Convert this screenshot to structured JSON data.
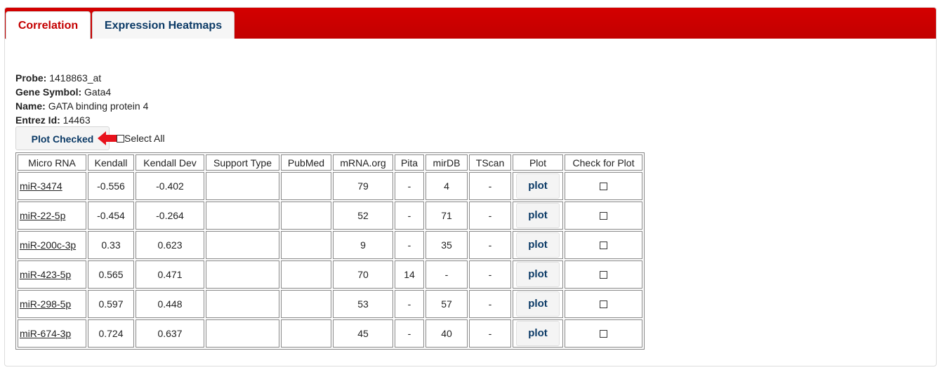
{
  "tabs": [
    {
      "label": "Correlation",
      "active": true
    },
    {
      "label": "Expression Heatmaps",
      "active": false
    }
  ],
  "info": {
    "probe_label": "Probe:",
    "probe_value": "1418863_at",
    "gene_symbol_label": "Gene Symbol:",
    "gene_symbol_value": "Gata4",
    "name_label": "Name:",
    "name_value": "GATA binding protein 4",
    "entrez_label": "Entrez Id:",
    "entrez_value": "14463"
  },
  "controls": {
    "plot_checked_label": "Plot Checked",
    "select_all_label": "Select All"
  },
  "table": {
    "headers": [
      "Micro RNA",
      "Kendall",
      "Kendall Dev",
      "Support Type",
      "PubMed",
      "mRNA.org",
      "Pita",
      "mirDB",
      "TScan",
      "Plot",
      "Check for Plot"
    ],
    "plot_label": "plot",
    "rows": [
      {
        "mirna": "miR-3474",
        "kendall": "-0.556",
        "kendall_dev": "-0.402",
        "support_type": "",
        "pubmed": "",
        "mrna_org": "79",
        "pita": "-",
        "mirdb": "4",
        "tscan": "-"
      },
      {
        "mirna": "miR-22-5p",
        "kendall": "-0.454",
        "kendall_dev": "-0.264",
        "support_type": "",
        "pubmed": "",
        "mrna_org": "52",
        "pita": "-",
        "mirdb": "71",
        "tscan": "-"
      },
      {
        "mirna": "miR-200c-3p",
        "kendall": "0.33",
        "kendall_dev": "0.623",
        "support_type": "",
        "pubmed": "",
        "mrna_org": "9",
        "pita": "-",
        "mirdb": "35",
        "tscan": "-"
      },
      {
        "mirna": "miR-423-5p",
        "kendall": "0.565",
        "kendall_dev": "0.471",
        "support_type": "",
        "pubmed": "",
        "mrna_org": "70",
        "pita": "14",
        "mirdb": "-",
        "tscan": "-"
      },
      {
        "mirna": "miR-298-5p",
        "kendall": "0.597",
        "kendall_dev": "0.448",
        "support_type": "",
        "pubmed": "",
        "mrna_org": "53",
        "pita": "-",
        "mirdb": "57",
        "tscan": "-"
      },
      {
        "mirna": "miR-674-3p",
        "kendall": "0.724",
        "kendall_dev": "0.637",
        "support_type": "",
        "pubmed": "",
        "mrna_org": "45",
        "pita": "-",
        "mirdb": "40",
        "tscan": "-"
      }
    ]
  },
  "colors": {
    "tabbar_red": "#c80000",
    "active_tab_text": "#c40000",
    "button_text": "#0b3a66",
    "arrow_red": "#e8121c"
  },
  "icons": {
    "arrow": "arrow-left-icon",
    "checkbox": "checkbox-icon"
  }
}
